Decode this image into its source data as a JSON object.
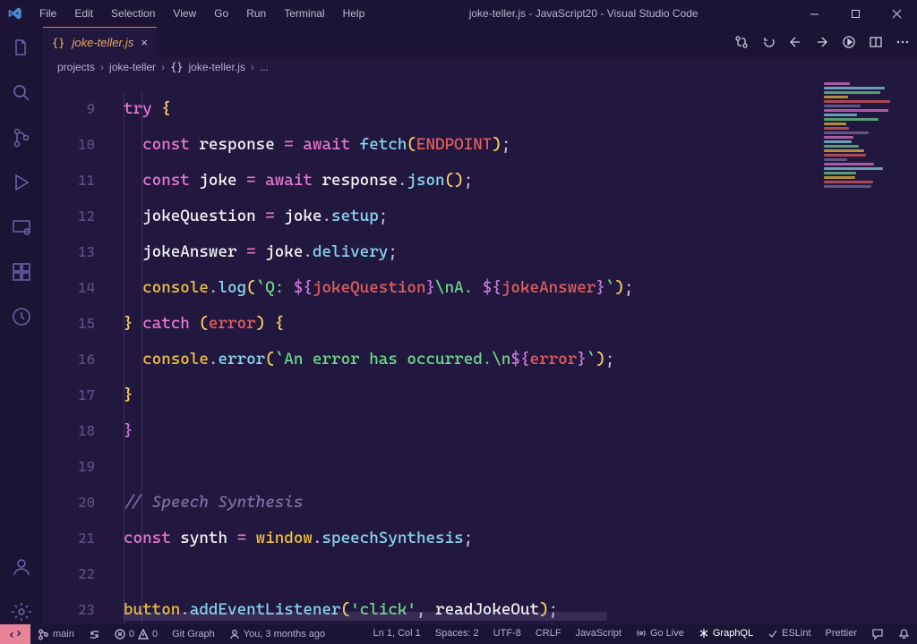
{
  "title": "joke-teller.js - JavaScript20 - Visual Studio Code",
  "menu": [
    "File",
    "Edit",
    "Selection",
    "View",
    "Go",
    "Run",
    "Terminal",
    "Help"
  ],
  "tab": {
    "label": "joke-teller.js"
  },
  "breadcrumb": [
    "projects",
    "joke-teller",
    "joke-teller.js",
    "..."
  ],
  "lineStart": 9,
  "lines": [
    [
      [
        "kw",
        "try "
      ],
      [
        "brace",
        "{"
      ]
    ],
    [
      [
        "sp",
        "  "
      ],
      [
        "kw",
        "const "
      ],
      [
        "var",
        "response "
      ],
      [
        "eq",
        "= "
      ],
      [
        "kw",
        "await "
      ],
      [
        "call",
        "fetch"
      ],
      [
        "paren",
        "("
      ],
      [
        "const",
        "ENDPOINT"
      ],
      [
        "paren",
        ")"
      ],
      [
        "semi",
        ";"
      ]
    ],
    [
      [
        "sp",
        "  "
      ],
      [
        "kw",
        "const "
      ],
      [
        "var",
        "joke "
      ],
      [
        "eq",
        "= "
      ],
      [
        "kw",
        "await "
      ],
      [
        "var",
        "response"
      ],
      [
        "dot",
        "."
      ],
      [
        "call",
        "json"
      ],
      [
        "paren",
        "()"
      ],
      [
        "semi",
        ";"
      ]
    ],
    [
      [
        "sp",
        "  "
      ],
      [
        "var",
        "jokeQuestion "
      ],
      [
        "eq",
        "= "
      ],
      [
        "var",
        "joke"
      ],
      [
        "dot",
        "."
      ],
      [
        "prop",
        "setup"
      ],
      [
        "semi",
        ";"
      ]
    ],
    [
      [
        "sp",
        "  "
      ],
      [
        "var",
        "jokeAnswer "
      ],
      [
        "eq",
        "= "
      ],
      [
        "var",
        "joke"
      ],
      [
        "dot",
        "."
      ],
      [
        "prop",
        "delivery"
      ],
      [
        "semi",
        ";"
      ]
    ],
    [
      [
        "sp",
        "  "
      ],
      [
        "obj",
        "console"
      ],
      [
        "dot",
        "."
      ],
      [
        "call",
        "log"
      ],
      [
        "paren",
        "("
      ],
      [
        "str",
        "`Q: "
      ],
      [
        "pbrace",
        "${"
      ],
      [
        "id2",
        "jokeQuestion"
      ],
      [
        "pbrace",
        "}"
      ],
      [
        "str",
        "\\nA. "
      ],
      [
        "pbrace",
        "${"
      ],
      [
        "id2",
        "jokeAnswer"
      ],
      [
        "pbrace",
        "}"
      ],
      [
        "str",
        "`"
      ],
      [
        "paren",
        ")"
      ],
      [
        "semi",
        ";"
      ]
    ],
    [
      [
        "brace",
        "} "
      ],
      [
        "kw",
        "catch "
      ],
      [
        "paren",
        "("
      ],
      [
        "const",
        "error"
      ],
      [
        "paren",
        ") "
      ],
      [
        "brace",
        "{"
      ]
    ],
    [
      [
        "sp",
        "  "
      ],
      [
        "obj",
        "console"
      ],
      [
        "dot",
        "."
      ],
      [
        "call",
        "error"
      ],
      [
        "paren",
        "("
      ],
      [
        "str",
        "`An error has occurred.\\n"
      ],
      [
        "pbrace",
        "${"
      ],
      [
        "id2",
        "error"
      ],
      [
        "pbrace",
        "}"
      ],
      [
        "str",
        "`"
      ],
      [
        "paren",
        ")"
      ],
      [
        "semi",
        ";"
      ]
    ],
    [
      [
        "brace",
        "}"
      ]
    ],
    [
      [
        "pbrace",
        "}"
      ]
    ],
    [],
    [
      [
        "cmt",
        "// Speech Synthesis"
      ]
    ],
    [
      [
        "kw",
        "const "
      ],
      [
        "var",
        "synth "
      ],
      [
        "eq",
        "= "
      ],
      [
        "obj",
        "window"
      ],
      [
        "dot",
        "."
      ],
      [
        "prop",
        "speechSynthesis"
      ],
      [
        "semi",
        ";"
      ]
    ],
    [],
    [
      [
        "obj",
        "button"
      ],
      [
        "dot",
        "."
      ],
      [
        "call",
        "addEventListener"
      ],
      [
        "paren",
        "("
      ],
      [
        "str",
        "'click'"
      ],
      [
        "semi",
        ", "
      ],
      [
        "var",
        "readJokeOut"
      ],
      [
        "paren",
        ")"
      ],
      [
        "semi",
        ";"
      ]
    ]
  ],
  "status": {
    "branch": "main",
    "errors": "0",
    "warnings": "0",
    "gitgraph": "Git Graph",
    "blame": "You, 3 months ago",
    "pos": "Ln 1, Col 1",
    "spaces": "Spaces: 2",
    "enc": "UTF-8",
    "eol": "CRLF",
    "lang": "JavaScript",
    "golive": "Go Live",
    "graphql": "GraphQL",
    "eslint": "ESLint",
    "prettier": "Prettier"
  }
}
